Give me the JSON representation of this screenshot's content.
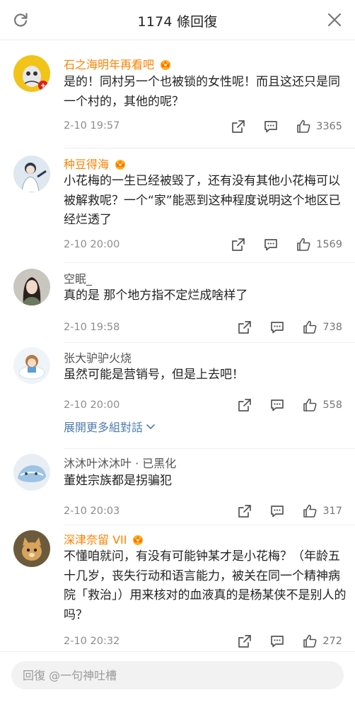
{
  "header": {
    "title": "1174 條回復",
    "refresh_icon": "refresh-icon",
    "close_icon": "close-icon"
  },
  "comments": [
    {
      "username": "石之海明年再看吧",
      "verified_crown": true,
      "username_color": "#ff8200",
      "text": "是的！同村另一个也被锁的女性呢！而且这还只是同一个村的，其他的呢？",
      "time": "2-10 19:57",
      "likes": "3365"
    },
    {
      "username": "种豆得海",
      "verified_crown": true,
      "username_color": "#ff8200",
      "text": "小花梅的一生已经被毁了，还有没有其他小花梅可以被解救呢？一个“家”能恶到这种程度说明这个地区已经烂透了",
      "time": "2-10 20:00",
      "likes": "1569"
    },
    {
      "username": "空眠_",
      "verified_crown": false,
      "username_color": "#555555",
      "text": "真的是 那个地方指不定烂成啥样了",
      "time": "2-10 19:58",
      "likes": "738"
    },
    {
      "username": "张大驴驴火烧",
      "verified_crown": false,
      "username_color": "#555555",
      "text": "虽然可能是营销号，但是上去吧！",
      "time": "2-10 20:00",
      "likes": "558"
    },
    {
      "username": "沐沐叶沐沐叶 · 已黑化",
      "verified_crown": false,
      "username_color": "#555555",
      "text": "董姓宗族都是拐骗犯",
      "time": "2-10 20:03",
      "likes": "317"
    },
    {
      "username": "深津奈留 VII",
      "verified_crown": true,
      "username_color": "#ff8200",
      "text": "不懂咱就问，有没有可能钟某才是小花梅？（年龄五十几岁，丧失行动和语言能力，被关在同一个精神病院「救治」）用来核对的血液真的是杨某侠不是别人的吗？",
      "time": "2-10 20:32",
      "likes": "272"
    }
  ],
  "expand_more": "展開更多組對話",
  "footer": {
    "reply_placeholder": "回復 @一句神吐槽"
  },
  "icons": {
    "share": "share-icon",
    "comment": "comment-icon",
    "like": "thumbs-up-icon",
    "expand": "chevron-down-icon",
    "crown": "crown-badge-icon"
  },
  "colors": {
    "accent_orange": "#ff8200",
    "link_blue": "#507daf",
    "meta_grey": "#8c8c8c"
  }
}
